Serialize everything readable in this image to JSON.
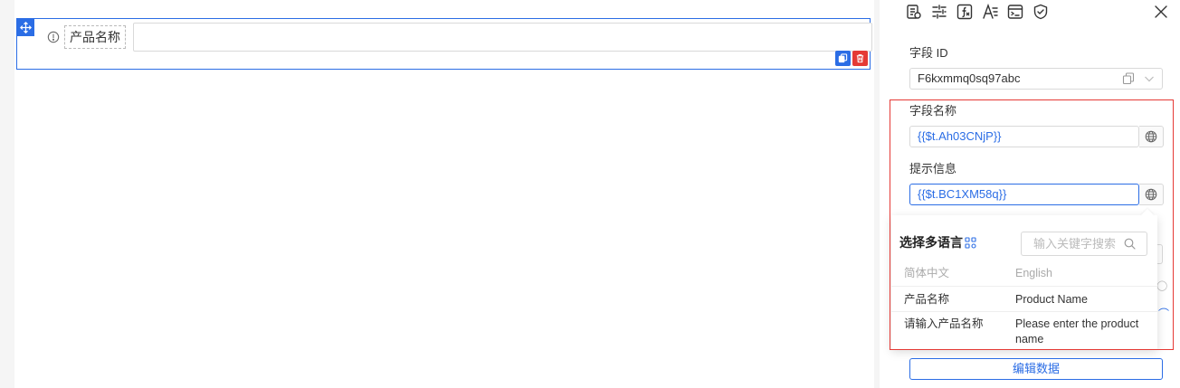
{
  "canvas": {
    "field_label": "产品名称"
  },
  "panel": {
    "toolbar_icons": [
      "field-settings-icon",
      "adjust-icon",
      "function-icon",
      "text-style-icon",
      "code-icon",
      "shield-icon"
    ],
    "field_id_label": "字段 ID",
    "field_id_value": "F6kxmmq0sq97abc",
    "field_name_label": "字段名称",
    "field_name_value": "{{$t.Ah03CNjP}}",
    "hint_label": "提示信息",
    "hint_value": "{{$t.BC1XM58q}}",
    "edit_data_button": "编辑数据"
  },
  "i18n_popup": {
    "title": "选择多语言",
    "search_placeholder": "输入关键字搜索",
    "columns": [
      "简体中文",
      "English"
    ],
    "rows": [
      {
        "zh": "产品名称",
        "en": "Product Name"
      },
      {
        "zh": "请输入产品名称",
        "en": "Please enter the product name"
      }
    ]
  },
  "colors": {
    "primary": "#2b6de5",
    "danger": "#e53935",
    "highlight_frame": "#e53935"
  }
}
